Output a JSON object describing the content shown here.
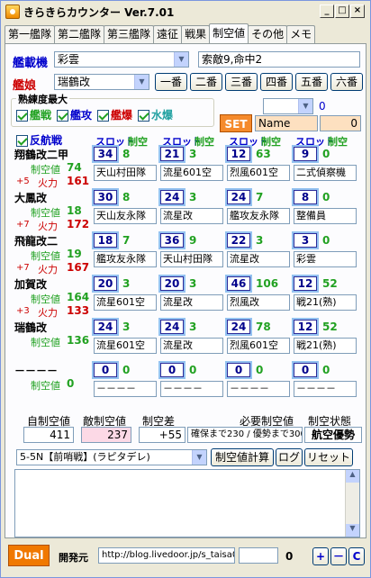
{
  "window": {
    "title": "きらきらカウンター Ver.7.01",
    "min": "_",
    "max": "□",
    "close": "×"
  },
  "tabs": [
    "第一艦隊",
    "第二艦隊",
    "第三艦隊",
    "遠征",
    "戦果",
    "制空値",
    "その他",
    "メモ"
  ],
  "carrier": {
    "label": "艦載機",
    "value": "彩雲",
    "note": "索敵9,命中2"
  },
  "ship_select": {
    "label": "艦娘",
    "value": "瑞鶴改",
    "buttons": [
      "一番",
      "二番",
      "三番",
      "四番",
      "五番",
      "六番"
    ]
  },
  "proficiency": {
    "title": "熟練度最大",
    "items": [
      {
        "label": "艦戦",
        "color": "#21a121"
      },
      {
        "label": "艦攻",
        "color": "#0000cc"
      },
      {
        "label": "艦爆",
        "color": "#cc0000"
      },
      {
        "label": "水爆",
        "color": "#21a1a1"
      }
    ]
  },
  "set_area": {
    "combo_value": "",
    "count": "0",
    "set_label": "SET",
    "name_value": "Name",
    "name_num": "0"
  },
  "anti_air_label": "反航戦",
  "col_headers": {
    "slot": "スロット",
    "aa": "制空"
  },
  "ships": [
    {
      "name": "翔鶴改二甲",
      "aa_label": "制空値",
      "aa": "74",
      "plus": "+5",
      "fp_label": "火力",
      "fp": "161",
      "slots": [
        {
          "n": "34",
          "aa": "8",
          "eq": "天山村田隊"
        },
        {
          "n": "21",
          "aa": "3",
          "eq": "流星601空"
        },
        {
          "n": "12",
          "aa": "63",
          "eq": "烈風601空"
        },
        {
          "n": "9",
          "aa": "0",
          "eq": "二式偵察機"
        }
      ]
    },
    {
      "name": "大鳳改",
      "aa_label": "制空値",
      "aa": "18",
      "plus": "+7",
      "fp_label": "火力",
      "fp": "172",
      "slots": [
        {
          "n": "30",
          "aa": "8",
          "eq": "天山友永隊"
        },
        {
          "n": "24",
          "aa": "3",
          "eq": "流星改"
        },
        {
          "n": "24",
          "aa": "7",
          "eq": "艦攻友永隊"
        },
        {
          "n": "8",
          "aa": "0",
          "eq": "整備員"
        }
      ]
    },
    {
      "name": "飛龍改二",
      "aa_label": "制空値",
      "aa": "19",
      "plus": "+7",
      "fp_label": "火力",
      "fp": "167",
      "slots": [
        {
          "n": "18",
          "aa": "7",
          "eq": "艦攻友永隊"
        },
        {
          "n": "36",
          "aa": "9",
          "eq": "天山村田隊"
        },
        {
          "n": "22",
          "aa": "3",
          "eq": "流星改"
        },
        {
          "n": "3",
          "aa": "0",
          "eq": "彩雲"
        }
      ]
    },
    {
      "name": "加賀改",
      "aa_label": "制空値",
      "aa": "164",
      "plus": "+3",
      "fp_label": "火力",
      "fp": "133",
      "slots": [
        {
          "n": "20",
          "aa": "3",
          "eq": "流星601空"
        },
        {
          "n": "20",
          "aa": "3",
          "eq": "流星改"
        },
        {
          "n": "46",
          "aa": "106",
          "eq": "烈風改"
        },
        {
          "n": "12",
          "aa": "52",
          "eq": "戦21(熟)"
        }
      ]
    },
    {
      "name": "瑞鶴改",
      "aa_label": "制空値",
      "aa": "136",
      "plus": "",
      "fp_label": "",
      "fp": "",
      "slots": [
        {
          "n": "24",
          "aa": "3",
          "eq": "流星601空"
        },
        {
          "n": "24",
          "aa": "3",
          "eq": "流星改"
        },
        {
          "n": "24",
          "aa": "78",
          "eq": "烈風601空"
        },
        {
          "n": "12",
          "aa": "52",
          "eq": "戦21(熟)"
        }
      ]
    },
    {
      "name": "－－－－",
      "aa_label": "制空値",
      "aa": "0",
      "plus": "",
      "fp_label": "",
      "fp": "",
      "slots": [
        {
          "n": "0",
          "aa": "0",
          "eq": "－－－－"
        },
        {
          "n": "0",
          "aa": "0",
          "eq": "－－－－"
        },
        {
          "n": "0",
          "aa": "0",
          "eq": "－－－－"
        },
        {
          "n": "0",
          "aa": "0",
          "eq": "－－－－"
        }
      ]
    }
  ],
  "summary": {
    "own_label": "自制空値",
    "own": "411",
    "enemy_label": "敵制空値",
    "enemy": "237",
    "diff_label": "制空差",
    "diff": "+55",
    "need_label": "必要制空値",
    "need": "確保まで230 / 優勢まで300",
    "state_label": "制空状態",
    "state": "航空優勢"
  },
  "map": {
    "value": "5-5N【前哨戦】(ラピタデレ)",
    "calc": "制空値計算",
    "log": "ログ",
    "reset": "リセット"
  },
  "footer": {
    "dual": "Dual",
    "dev_label": "開発元",
    "url": "http://blog.livedoor.jp/s_taisa0/",
    "field": "",
    "count": "0",
    "plus": "+",
    "minus": "－",
    "c": "C"
  }
}
